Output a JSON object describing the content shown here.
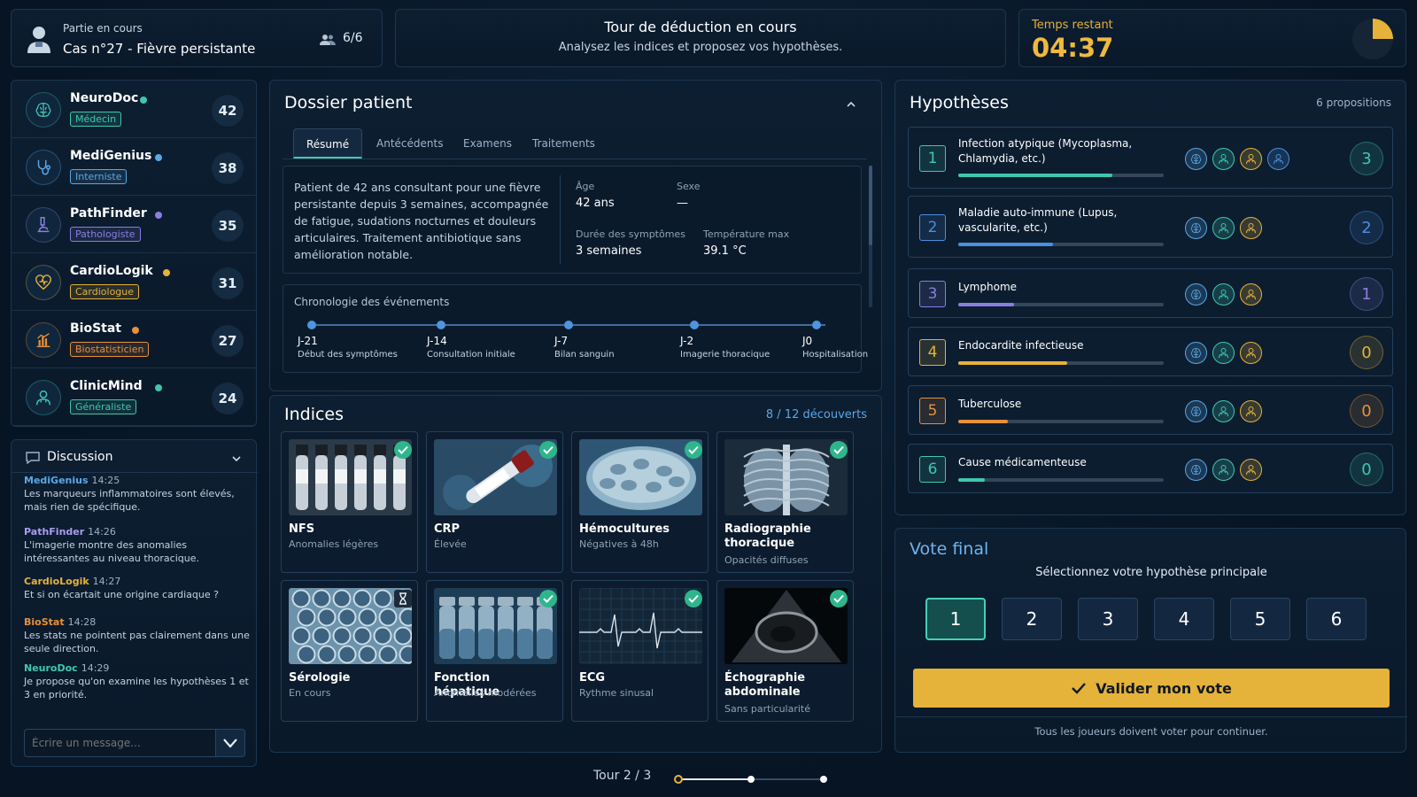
{
  "header": {
    "status_label": "Partie en cours",
    "case_title": "Cas n°27 - Fièvre persistante",
    "players_count": "6/6",
    "round_title": "Tour de déduction en cours",
    "round_subtitle": "Analysez les indices et proposez vos hypothèses.",
    "timer_label": "Temps restant",
    "timer_value": "04:37",
    "timer_fraction": 0.25
  },
  "players": [
    {
      "name": "NeuroDoc",
      "role": "Médecin",
      "score": "42",
      "color": "#3fc7b0",
      "icon": "brain-icon"
    },
    {
      "name": "MediGenius",
      "role": "Interniste",
      "score": "38",
      "color": "#5aa8e6",
      "icon": "stethoscope-icon"
    },
    {
      "name": "PathFinder",
      "role": "Pathologiste",
      "score": "35",
      "color": "#8a7ee0",
      "icon": "microscope-icon"
    },
    {
      "name": "CardioLogik",
      "role": "Cardiologue",
      "score": "31",
      "color": "#e5b23a",
      "icon": "heart-icon"
    },
    {
      "name": "BioStat",
      "role": "Biostatisticien",
      "score": "27",
      "color": "#e8903a",
      "icon": "bar-chart-icon"
    },
    {
      "name": "ClinicMind",
      "role": "Généraliste",
      "score": "24",
      "color": "#3fc7b0",
      "icon": "doctor-icon"
    }
  ],
  "discussion": {
    "title": "Discussion",
    "input_placeholder": "Écrire un message...",
    "messages": [
      {
        "author": "MediGenius",
        "time": "14:25",
        "text": "Les marqueurs inflammatoires sont élevés, mais rien de spécifique.",
        "color": "#5aa8e6"
      },
      {
        "author": "PathFinder",
        "time": "14:26",
        "text": "L'imagerie montre des anomalies intéressantes au niveau thoracique.",
        "color": "#a99cf0"
      },
      {
        "author": "CardioLogik",
        "time": "14:27",
        "text": "Et si on écartait une origine cardiaque ?",
        "color": "#e5b23a"
      },
      {
        "author": "BioStat",
        "time": "14:28",
        "text": "Les stats ne pointent pas clairement dans une seule direction.",
        "color": "#e8903a"
      },
      {
        "author": "NeuroDoc",
        "time": "14:29",
        "text": "Je propose qu'on examine les hypothèses 1 et 3 en priorité.",
        "color": "#3fc7b0"
      }
    ]
  },
  "dossier": {
    "title": "Dossier patient",
    "tabs": [
      "Résumé",
      "Antécédents",
      "Examens",
      "Traitements"
    ],
    "summary": "Patient de 42 ans consultant pour une fièvre persistante depuis 3 semaines, accompagnée de fatigue, sudations nocturnes et douleurs articulaires. Traitement antibiotique sans amélioration notable.",
    "age_label": "Âge",
    "age_value": "42 ans",
    "sex_label": "Sexe",
    "sex_value": "—",
    "duration_label": "Durée des symptômes",
    "duration_value": "3 semaines",
    "temp_label": "Température max",
    "temp_value": "39.1 °C",
    "timeline_title": "Chronologie des événements",
    "timeline": [
      {
        "day": "J-21",
        "label": "Début des symptômes"
      },
      {
        "day": "J-14",
        "label": "Consultation initiale"
      },
      {
        "day": "J-7",
        "label": "Bilan sanguin"
      },
      {
        "day": "J-2",
        "label": "Imagerie thoracique"
      },
      {
        "day": "J0",
        "label": "Hospitalisation"
      }
    ]
  },
  "indices": {
    "title": "Indices",
    "count": "8 / 12 découverts",
    "cards": [
      {
        "title": "NFS",
        "subtitle": "Anomalies légères",
        "status": "check",
        "img": "tubes"
      },
      {
        "title": "CRP",
        "subtitle": "Élevée",
        "status": "check",
        "img": "tube-hand"
      },
      {
        "title": "Hémocultures",
        "subtitle": "Négatives à 48h",
        "status": "check",
        "img": "petri"
      },
      {
        "title": "Radiographie thoracique",
        "subtitle": "Opacités diffuses",
        "status": "check",
        "img": "xray"
      },
      {
        "title": "Sérologie",
        "subtitle": "En cours",
        "status": "pending",
        "img": "wells"
      },
      {
        "title": "Fonction hépatique",
        "subtitle": "Anomalies modérées",
        "status": "check",
        "img": "vials"
      },
      {
        "title": "ECG",
        "subtitle": "Rythme sinusal",
        "status": "check",
        "img": "ecg"
      },
      {
        "title": "Échographie abdominale",
        "subtitle": "Sans particularité",
        "status": "check",
        "img": "echo"
      }
    ]
  },
  "hypotheses": {
    "title": "Hypothèses",
    "count": "6 propositions",
    "items": [
      {
        "num": "1",
        "text": "Infection atypique (Mycoplasma, Chlamydia, etc.)",
        "votes": "3",
        "progress": 0.75,
        "color": "#3fc7b0",
        "voters": [
          "brain-icon",
          "doctor-icon",
          "doctor-icon",
          "doctor-icon"
        ]
      },
      {
        "num": "2",
        "text": "Maladie auto-immune (Lupus, vascularite, etc.)",
        "votes": "2",
        "progress": 0.46,
        "color": "#4a8fe0",
        "voters": [
          "brain-icon",
          "doctor-icon",
          "doctor-icon"
        ]
      },
      {
        "num": "3",
        "text": "Lymphome",
        "votes": "1",
        "progress": 0.27,
        "color": "#8a7ee0",
        "voters": [
          "brain-icon",
          "doctor-icon",
          "doctor-icon"
        ]
      },
      {
        "num": "4",
        "text": "Endocardite infectieuse",
        "votes": "0",
        "progress": 0.53,
        "color": "#e5b23a",
        "voters": [
          "brain-icon",
          "doctor-icon",
          "doctor-icon"
        ]
      },
      {
        "num": "5",
        "text": "Tuberculose",
        "votes": "0",
        "progress": 0.24,
        "color": "#e8903a",
        "voters": [
          "brain-icon",
          "doctor-icon",
          "doctor-icon"
        ]
      },
      {
        "num": "6",
        "text": "Cause médicamenteuse",
        "votes": "0",
        "progress": 0.13,
        "color": "#3fc7b0",
        "voters": [
          "brain-icon",
          "doctor-icon",
          "doctor-icon"
        ]
      }
    ]
  },
  "vote": {
    "title": "Vote final",
    "prompt": "Sélectionnez votre hypothèse principale",
    "options": [
      "1",
      "2",
      "3",
      "4",
      "5",
      "6"
    ],
    "selected": "1",
    "validate_label": "Valider mon vote",
    "footer": "Tous les joueurs doivent voter pour continuer."
  },
  "round": {
    "label": "Tour 2 / 3",
    "current": 2,
    "total": 3
  }
}
